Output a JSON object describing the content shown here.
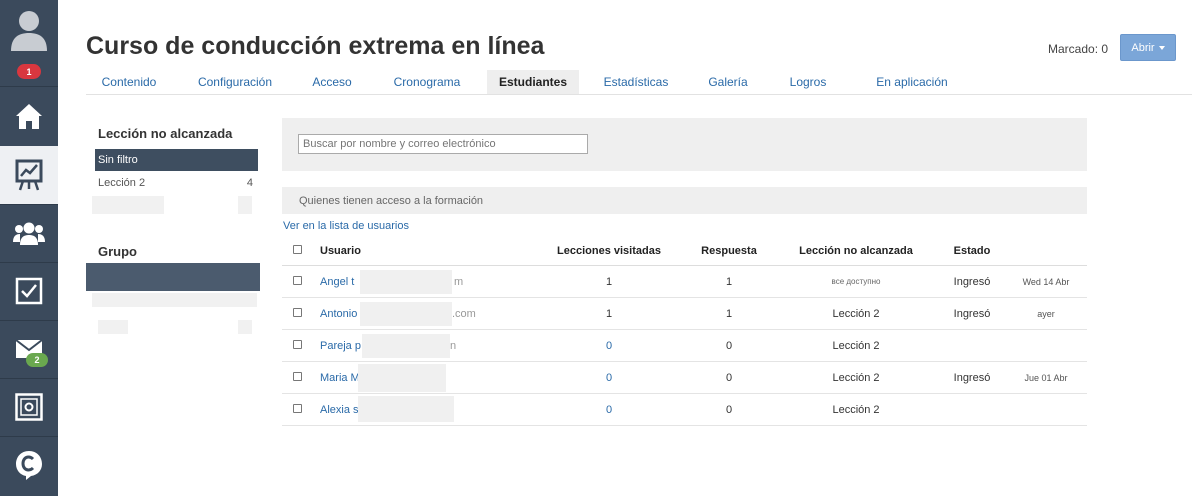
{
  "rail": {
    "notifications_badge": "1",
    "mail_badge": "2",
    "items": [
      {
        "icon": "home-icon"
      },
      {
        "icon": "chart-board-icon"
      },
      {
        "icon": "users-icon"
      },
      {
        "icon": "checkbox-icon"
      },
      {
        "icon": "mail-icon"
      },
      {
        "icon": "safe-icon"
      },
      {
        "icon": "chat-logo-icon"
      }
    ]
  },
  "header": {
    "title": "Curso de conducción extrema en línea",
    "marked": "Marcado: 0",
    "open_button": "Abrir"
  },
  "tabs": [
    {
      "label": "Contenido"
    },
    {
      "label": "Configuración"
    },
    {
      "label": "Acceso"
    },
    {
      "label": "Cronograma"
    },
    {
      "label": "Estudiantes",
      "active": true
    },
    {
      "label": "Estadísticas"
    },
    {
      "label": "Galería"
    },
    {
      "label": "Logros"
    },
    {
      "label": "En aplicación"
    }
  ],
  "filters": {
    "lesson_heading": "Lección no alcanzada",
    "no_filter": "Sin filtro",
    "lesson2_label": "Lección 2",
    "lesson2_count": "4",
    "group_heading": "Grupo"
  },
  "search": {
    "placeholder": "Buscar por nombre y correo electrónico"
  },
  "access_bar": "Quienes tienen acceso a la formación",
  "user_list_link": "Ver en la lista de usuarios",
  "table": {
    "headers": {
      "user": "Usuario",
      "lessons": "Lecciones visitadas",
      "answer": "Respuesta",
      "unreached": "Lección no alcanzada",
      "status": "Estado"
    },
    "rows": [
      {
        "name": "Angel t",
        "suffix": "m",
        "lessons": "1",
        "answer": "1",
        "unreached": "все доступно",
        "status": "Ingresó",
        "date": "Wed 14 Abr"
      },
      {
        "name": "Antonio",
        "suffix": ".com",
        "lessons": "1",
        "answer": "1",
        "unreached": "Lección 2",
        "status": "Ingresó",
        "date": "ayer"
      },
      {
        "name": "Pareja p",
        "suffix": "n",
        "lessons": "0",
        "answer": "0",
        "unreached": "Lección 2",
        "status": "",
        "date": ""
      },
      {
        "name": "Maria M",
        "suffix": "",
        "lessons": "0",
        "answer": "0",
        "unreached": "Lección 2",
        "status": "Ingresó",
        "date": "Jue 01 Abr"
      },
      {
        "name": "Alexia s",
        "suffix": "",
        "lessons": "0",
        "answer": "0",
        "unreached": "Lección 2",
        "status": "",
        "date": ""
      }
    ]
  },
  "colors": {
    "rail": "#3b4a5c",
    "link": "#2a6aa8",
    "accent_button": "#7ba6d8",
    "badge_red": "#d9373f",
    "badge_green": "#6aa84f"
  }
}
